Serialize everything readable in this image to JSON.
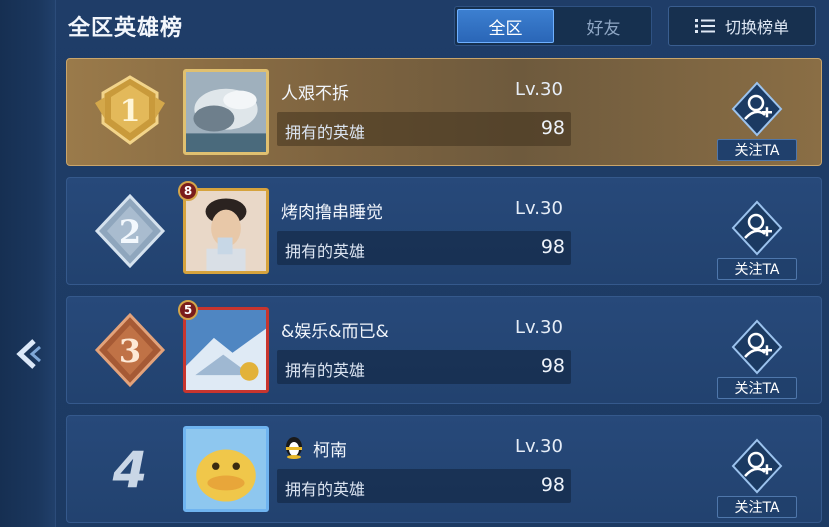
{
  "header": {
    "title": "全区英雄榜",
    "tabs": [
      {
        "label": "全区",
        "active": true
      },
      {
        "label": "好友",
        "active": false
      }
    ],
    "switch_label": "切换榜单"
  },
  "colors": {
    "background": "#1d3a63",
    "row": "#24446f",
    "gold_row": "#8a6e45",
    "active_tab": "#2f6fc2"
  },
  "rows": [
    {
      "rank": "1",
      "name": "人艰不拆",
      "level": "Lv.30",
      "hero_label": "拥有的英雄",
      "hero_count": "98",
      "follow_label": "关注TA"
    },
    {
      "rank": "2",
      "badge": "8",
      "name": "烤肉撸串睡觉",
      "level": "Lv.30",
      "hero_label": "拥有的英雄",
      "hero_count": "98",
      "follow_label": "关注TA"
    },
    {
      "rank": "3",
      "badge": "5",
      "name": "&娱乐&而已&",
      "level": "Lv.30",
      "hero_label": "拥有的英雄",
      "hero_count": "98",
      "follow_label": "关注TA"
    },
    {
      "rank": "4",
      "name": "柯南",
      "level": "Lv.30",
      "hero_label": "拥有的英雄",
      "hero_count": "98",
      "follow_label": "关注TA"
    }
  ]
}
